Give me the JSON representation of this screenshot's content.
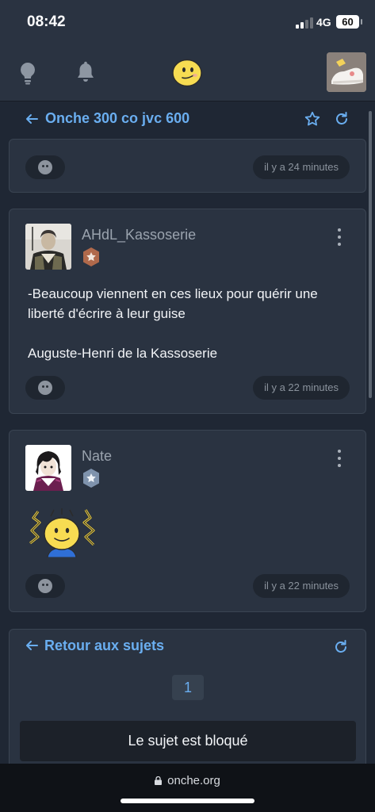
{
  "status_bar": {
    "time": "08:42",
    "network": "4G",
    "battery": "60"
  },
  "topic": {
    "title": "Onche 300 co jvc 600"
  },
  "posts": [
    {
      "timestamp": "il y a 24 minutes"
    },
    {
      "username": "AHdL_Kassoserie",
      "badge": "bronze",
      "text": [
        "-Beaucoup viennent en ces lieux pour quérir une liberté d'écrire à leur guise",
        "Auguste-Henri de la Kassoserie"
      ],
      "timestamp": "il y a 22 minutes"
    },
    {
      "username": "Nate",
      "badge": "silver",
      "timestamp": "il y a 22 minutes"
    }
  ],
  "footer": {
    "back_label": "Retour aux sujets",
    "page": "1",
    "locked_label": "Le sujet est bloqué"
  },
  "browser": {
    "url": "onche.org"
  },
  "colors": {
    "accent": "#6aaef0",
    "background": "#1f2734",
    "card": "#2a3341"
  }
}
